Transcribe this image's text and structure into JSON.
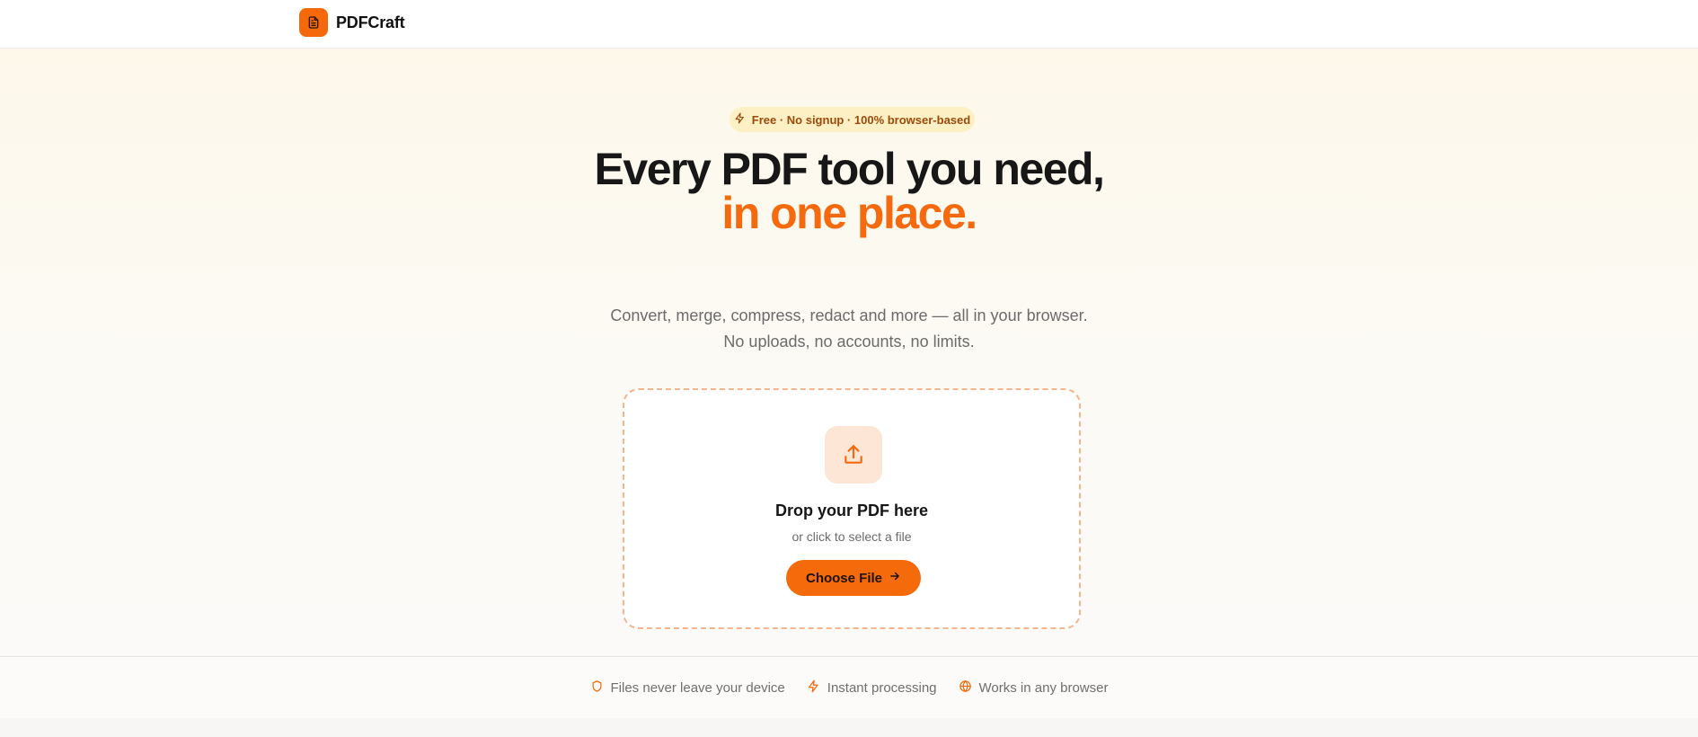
{
  "brand": {
    "name": "PDFCraft",
    "logo_icon": "document-icon"
  },
  "hero": {
    "badge": {
      "icon": "lightning-icon",
      "text": "Free · No signup · 100% browser-based"
    },
    "headline_line1": "Every PDF tool you need,",
    "headline_line2": "in one place.",
    "subtitle_line1": "Convert, merge, compress, redact and more — all in your browser.",
    "subtitle_line2": "No uploads, no accounts, no limits."
  },
  "dropzone": {
    "icon": "upload-icon",
    "title": "Drop your PDF here",
    "subtitle": "or click to select a file",
    "button_label": "Choose File",
    "button_icon": "arrow-right-icon"
  },
  "features": [
    {
      "icon": "shield-icon",
      "label": "Files never leave your device"
    },
    {
      "icon": "lightning-icon",
      "label": "Instant processing"
    },
    {
      "icon": "globe-icon",
      "label": "Works in any browser"
    }
  ],
  "colors": {
    "accent": "#f56a0b",
    "accent_light": "#fde6d6",
    "badge_bg": "#fdf0c4",
    "text_dark": "#171717",
    "text_muted": "#6b6b6b"
  }
}
